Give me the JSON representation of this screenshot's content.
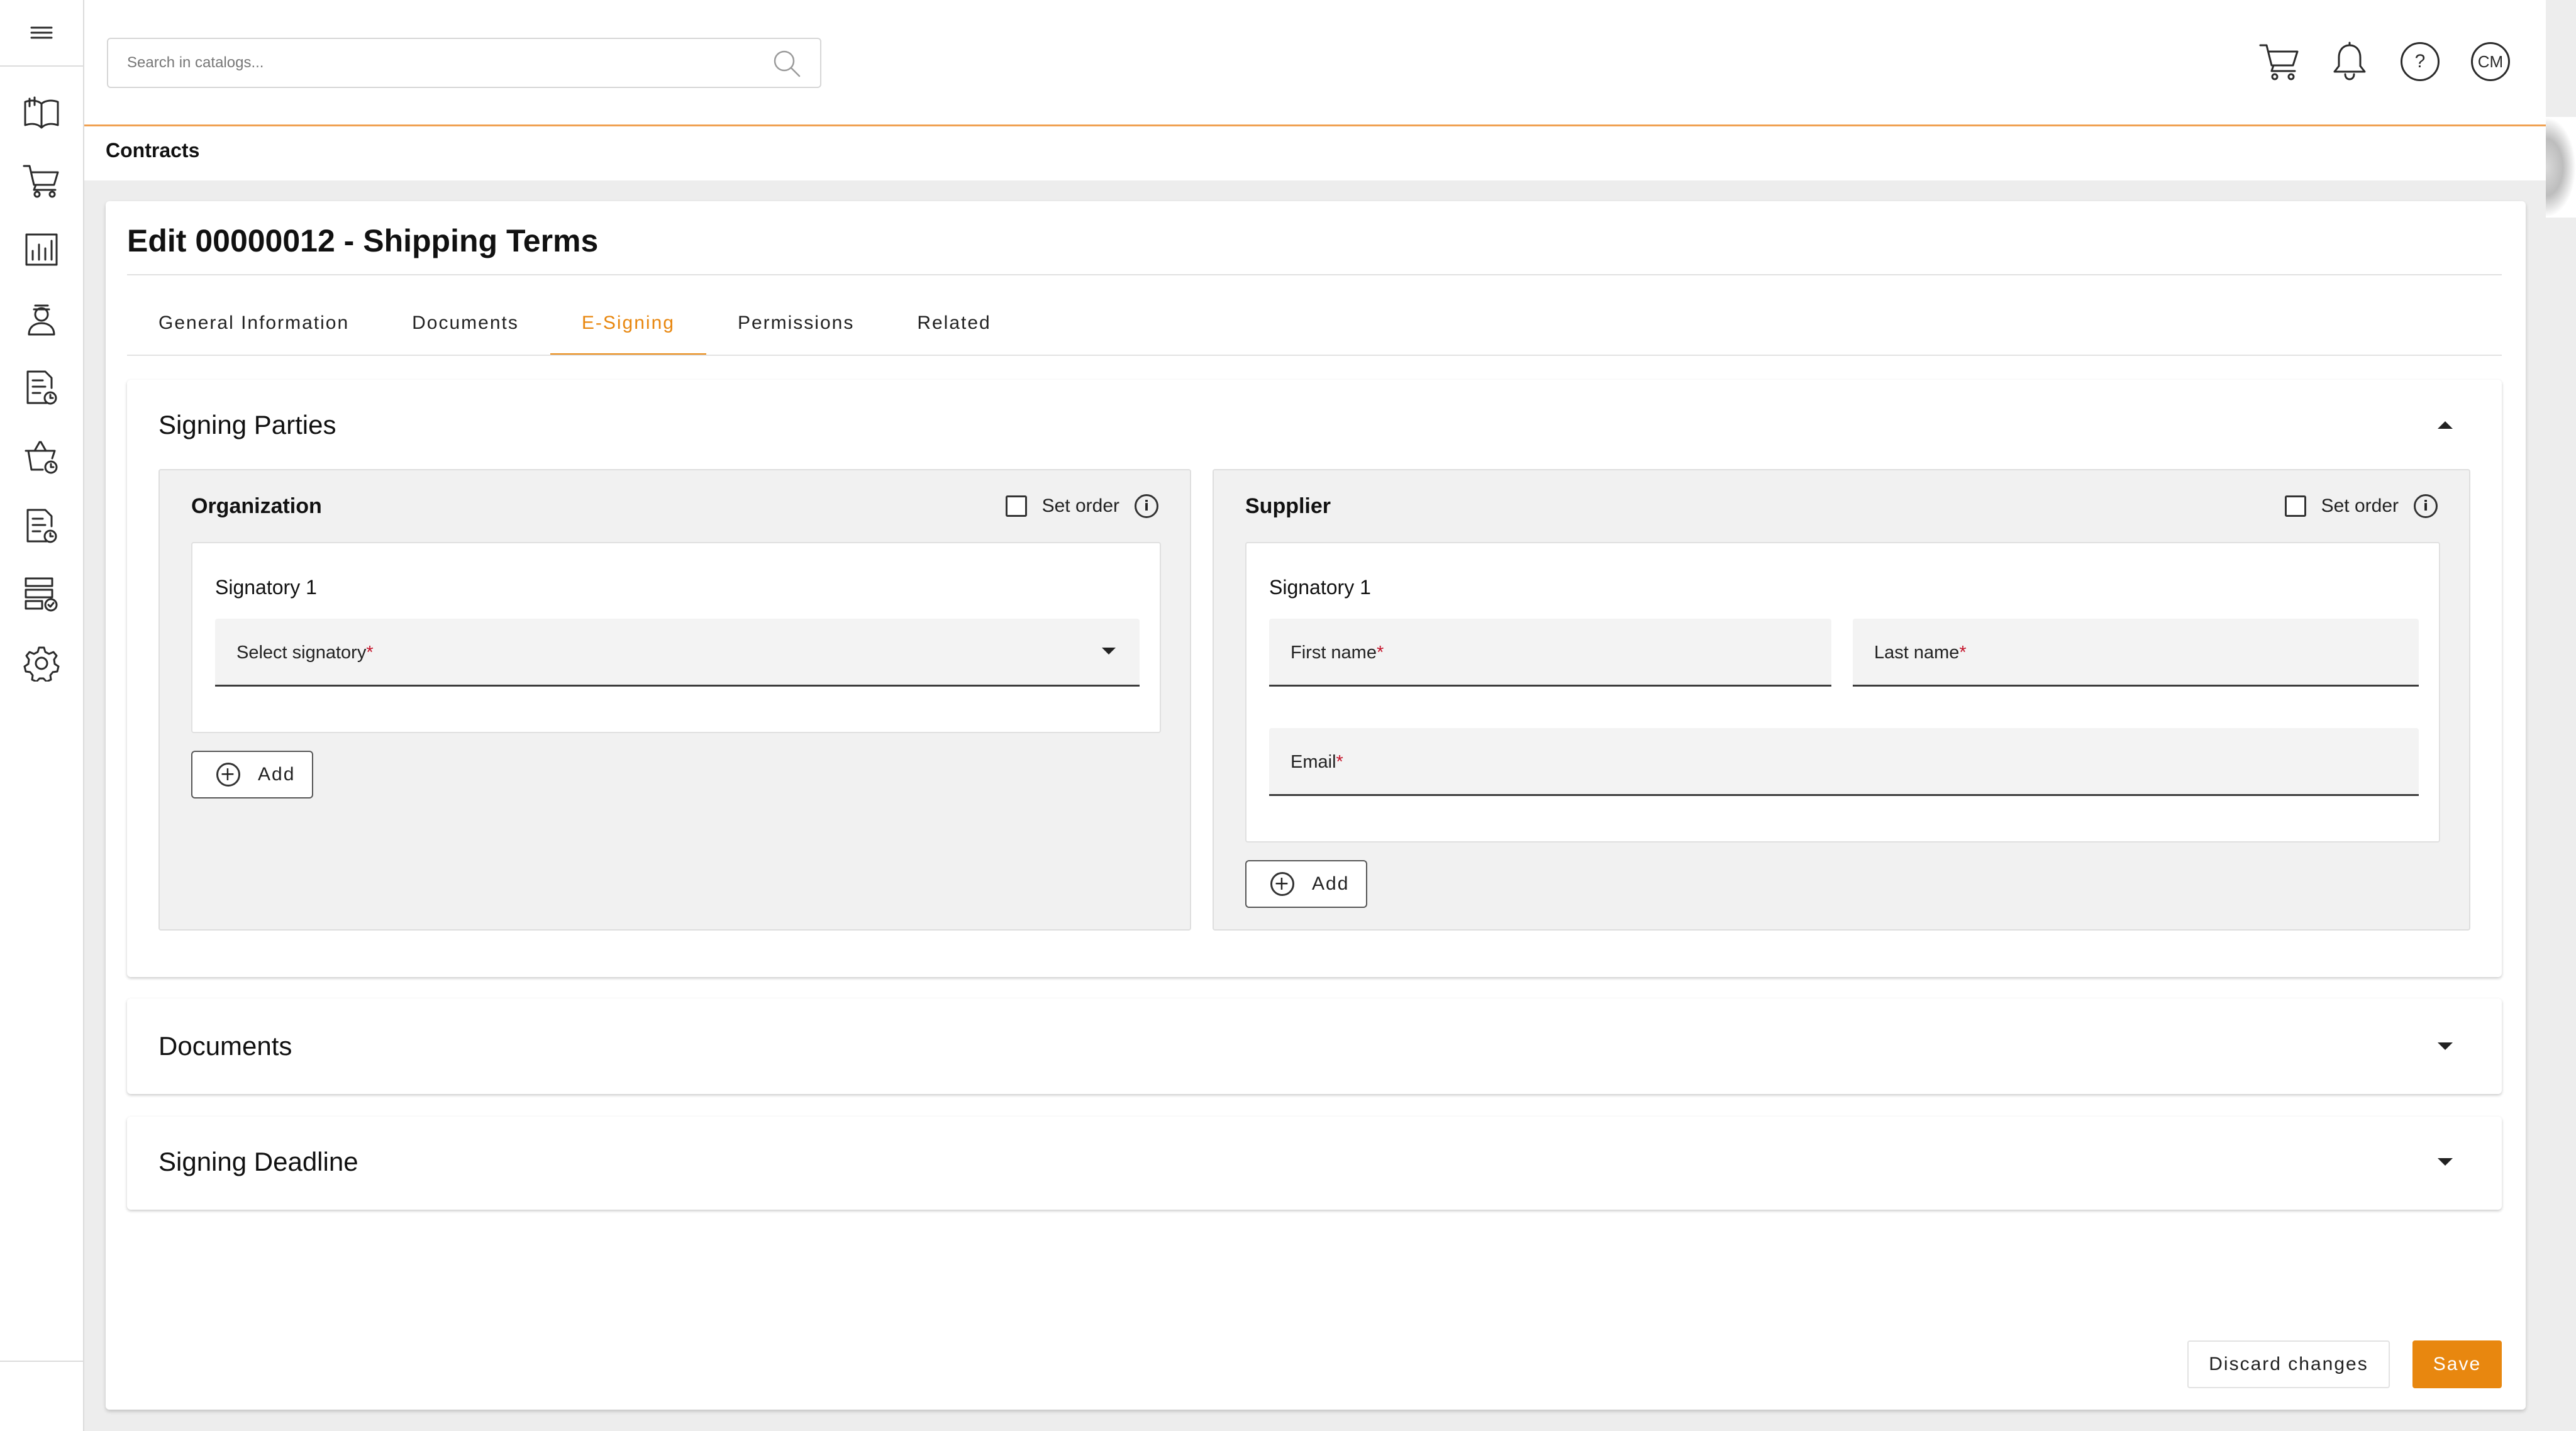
{
  "search": {
    "placeholder": "Search in catalogs..."
  },
  "topbar": {
    "help_label": "?",
    "avatar_initials": "CM"
  },
  "breadcrumb": "Contracts",
  "page": {
    "title": "Edit 00000012 - Shipping Terms"
  },
  "tabs": [
    {
      "label": "General Information",
      "active": false
    },
    {
      "label": "Documents",
      "active": false
    },
    {
      "label": "E-Signing",
      "active": true
    },
    {
      "label": "Permissions",
      "active": false
    },
    {
      "label": "Related",
      "active": false
    }
  ],
  "signing_parties": {
    "title": "Signing Parties",
    "organization": {
      "title": "Organization",
      "set_order_label": "Set order",
      "signatory_title": "Signatory 1",
      "select_label": "Select signatory",
      "add_label": "Add"
    },
    "supplier": {
      "title": "Supplier",
      "set_order_label": "Set order",
      "signatory_title": "Signatory 1",
      "first_name_label": "First name",
      "last_name_label": "Last name",
      "email_label": "Email",
      "add_label": "Add"
    },
    "required_mark": "*"
  },
  "sections": {
    "documents_title": "Documents",
    "deadline_title": "Signing Deadline"
  },
  "footer": {
    "discard_label": "Discard changes",
    "save_label": "Save"
  },
  "icons": {
    "sidebar": [
      "book-icon",
      "cart-icon",
      "chart-icon",
      "user-icon",
      "document-clock-icon",
      "basket-clock-icon",
      "document-clock-icon",
      "list-check-icon",
      "gear-icon"
    ],
    "top": [
      "cart-icon",
      "bell-icon",
      "help-icon",
      "avatar"
    ]
  },
  "colors": {
    "accent": "#e8870f",
    "required": "#c4142b"
  }
}
